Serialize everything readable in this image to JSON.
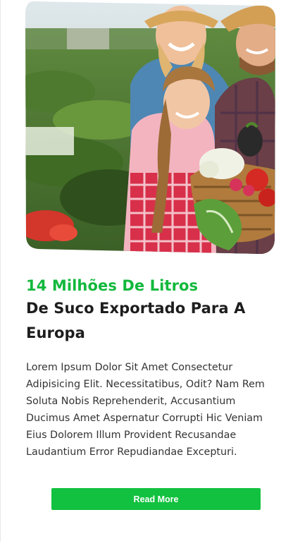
{
  "card": {
    "image_alt": "Family holding a basket of vegetables in a garden",
    "headline_accent": "14 Milhões De Litros",
    "headline_main": "De Suco Exportado Para A Europa",
    "body": "Lorem Ipsum Dolor Sit Amet Consectetur Adipisicing Elit. Necessitatibus, Odit? Nam Rem Soluta Nobis Reprehenderit, Accusantium Ducimus Amet Aspernatur Corrupti Hic Veniam Eius Dolorem Illum Provident Recusandae Laudantium Error Repudiandae Excepturi.",
    "button_label": "Read More"
  },
  "colors": {
    "accent": "#12b83c",
    "button": "#12c13f",
    "heading": "#1d1d1d",
    "body_text": "#333333"
  }
}
